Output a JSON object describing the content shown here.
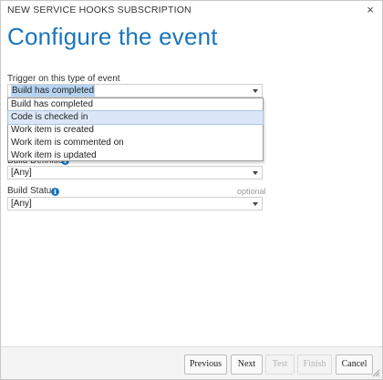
{
  "dialog": {
    "title": "NEW SERVICE HOOKS SUBSCRIPTION",
    "close_glyph": "×",
    "heading": "Configure the event"
  },
  "trigger": {
    "label": "Trigger on this type of event",
    "selected": "Build has completed",
    "options": [
      "Build has completed",
      "Code is checked in",
      "Work item is created",
      "Work item is commented on",
      "Work item is updated"
    ],
    "highlighted_option": "Code is checked in"
  },
  "build_definition": {
    "label": "Build Definition",
    "value": "[Any]"
  },
  "build_status": {
    "label": "Build Status",
    "optional": "optional",
    "value": "[Any]"
  },
  "icons": {
    "info": "i",
    "close": "close-icon",
    "resize": "resize-grip-icon"
  },
  "buttons": {
    "previous": "Previous",
    "next": "Next",
    "test": "Test",
    "finish": "Finish",
    "cancel": "Cancel"
  },
  "colors": {
    "accent": "#1b75bb",
    "selection": "#b6d4f2",
    "highlight": "#dbe7f7"
  }
}
